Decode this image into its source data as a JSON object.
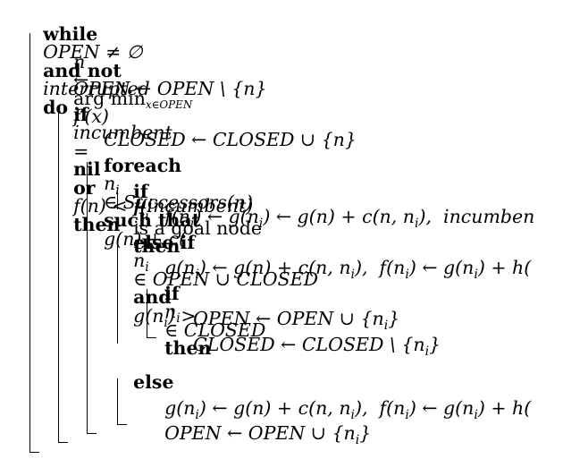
{
  "algorithm": {
    "lines": {
      "l01": {
        "kw1": "while",
        "expr1": "OPEN ≠ ∅",
        "kw2": "and not",
        "expr2": "interrupted",
        "kw3": "do"
      },
      "l02": {
        "lhs": "n",
        "arrow": "←",
        "op": "arg min",
        "sub": "x∈OPEN",
        "expr": "f′(x)"
      },
      "l03": {
        "expr": "OPEN ← OPEN \\ {n}"
      },
      "l04": {
        "kw1": "if",
        "expr1": "incumbent",
        "eq": "=",
        "kw2": "nil",
        "kw3": "or",
        "expr2": "f(n) < f(incumbent)",
        "kw4": "then"
      },
      "l05": {
        "expr": "CLOSED ← CLOSED ∪ {n}"
      },
      "l06": {
        "kw1": "foreach",
        "expr1": "n",
        "sub1": "i",
        "expr2": "∈ Successors(n)",
        "kw2": "such that",
        "expr3": "g(n) + c("
      },
      "l07": {
        "kw1": "if",
        "expr1": "n",
        "sub1": "i",
        "text1": "is a goal node",
        "kw2": "then"
      },
      "l08": {
        "expr": "f(n",
        "sub1": "i",
        "expr2": ") ← g(n",
        "sub2": "i",
        "expr3": ") ← g(n) + c(n, n",
        "sub3": "i",
        "expr4": "),  incumben"
      },
      "l09": {
        "kw1": "else if",
        "expr1": "n",
        "sub1": "i",
        "expr2": "∈ OPEN ∪ CLOSED",
        "kw2": "and",
        "expr3": "g(n",
        "sub2": "i",
        "expr4": ") >"
      },
      "l10": {
        "expr": "g(n",
        "sub1": "i",
        "expr2": ") ← g(n) + c(n, n",
        "sub2": "i",
        "expr3": "),  f(n",
        "sub3": "i",
        "expr4": ") ← g(n",
        "sub4": "i",
        "expr5": ") + h("
      },
      "l11": {
        "kw1": "if",
        "expr1": "n",
        "sub1": "i",
        "expr2": "∈ CLOSED",
        "kw2": "then"
      },
      "l12": {
        "expr": "OPEN ← OPEN ∪ {n",
        "sub1": "i",
        "expr2": "}"
      },
      "l13": {
        "expr": "CLOSED ← CLOSED \\ {n",
        "sub1": "i",
        "expr2": "}"
      },
      "l14": {
        "kw1": "else"
      },
      "l15": {
        "expr": "g(n",
        "sub1": "i",
        "expr2": ") ← g(n) + c(n, n",
        "sub2": "i",
        "expr3": "),  f(n",
        "sub3": "i",
        "expr4": ") ← g(n",
        "sub4": "i",
        "expr5": ") + h("
      },
      "l16": {
        "expr": "OPEN ← OPEN ∪ {n",
        "sub1": "i",
        "expr2": "}"
      }
    }
  }
}
